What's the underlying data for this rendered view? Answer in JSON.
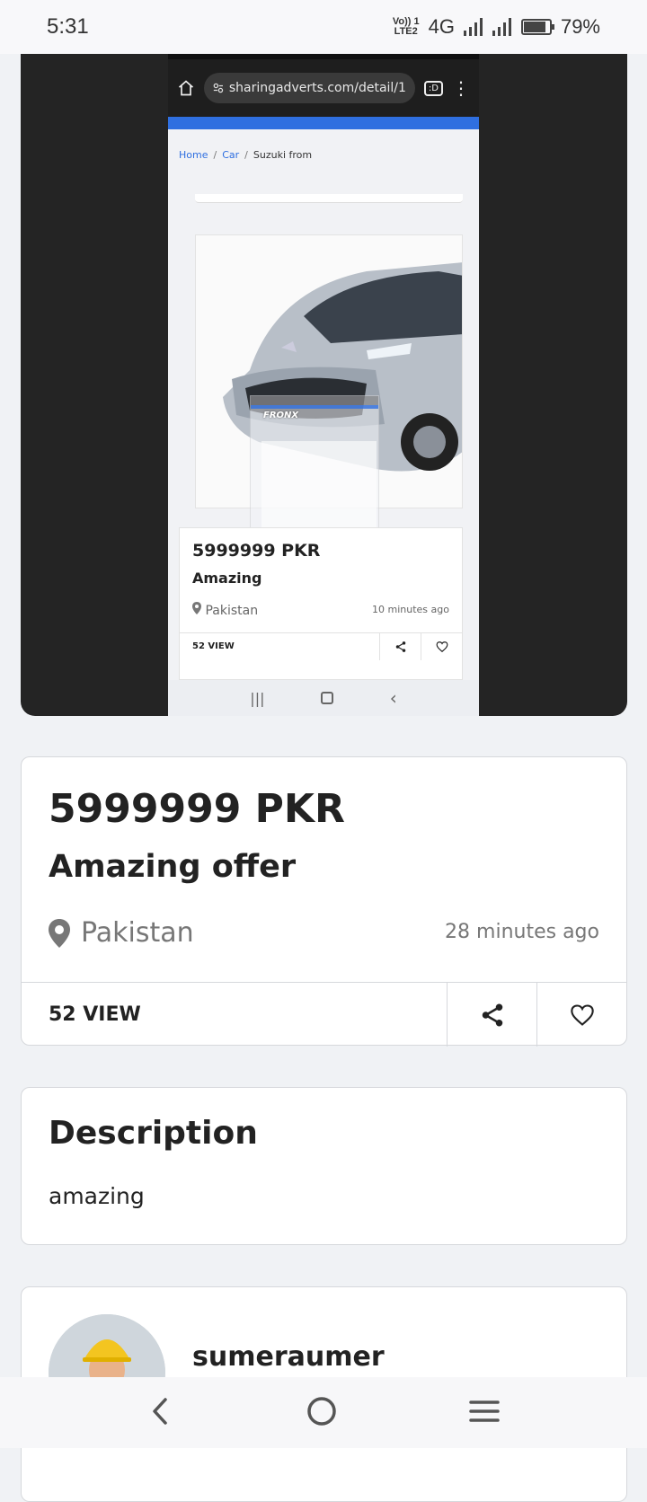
{
  "status_bar": {
    "time": "5:31",
    "network_top": "Vo)) 1",
    "network_bottom": "LTE2",
    "network_type": "4G",
    "battery": "79%",
    "battery_level": 0.79
  },
  "embedded_screenshot": {
    "url": "sharingadverts.com/detail/1",
    "tabs_badge": ":D",
    "breadcrumb": {
      "home": "Home",
      "sep1": "/",
      "category": "Car",
      "sep2": "/",
      "current": "Suzuki from"
    },
    "listing": {
      "price": "5999999 PKR",
      "title": "Amazing",
      "location": "Pakistan",
      "time": "10 minutes ago",
      "views": "52 VIEW"
    },
    "car_badge": "FRONX"
  },
  "listing": {
    "price": "5999999 PKR",
    "title": "Amazing offer",
    "location": "Pakistan",
    "time_ago": "28 minutes ago",
    "views": "52 VIEW"
  },
  "description": {
    "heading": "Description",
    "text": "amazing"
  },
  "seller": {
    "name": "sumeraumer"
  },
  "icons": {
    "location": "map-pin-icon",
    "share": "share-icon",
    "favorite": "heart-icon"
  },
  "colors": {
    "accent_blue": "#2f6fe0",
    "page_bg": "#f0f2f5",
    "dark_frame": "#242424"
  }
}
